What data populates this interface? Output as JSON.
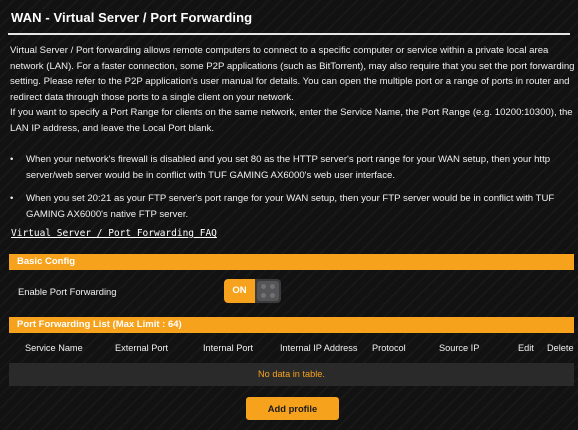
{
  "page": {
    "title": "WAN - Virtual Server / Port Forwarding",
    "description": [
      "Virtual Server / Port forwarding allows remote computers to connect to a specific computer or service within a private local area network (LAN). For a faster connection, some P2P applications (such as BitTorrent), may also require that you set the port forwarding setting. Please refer to the P2P application's user manual for details. You can open the multiple port or a range of ports in router and redirect data through those ports to a single client on your network.",
      "If you want to specify a Port Range for clients on the same network, enter the Service Name, the Port Range (e.g. 10200:10300), the LAN IP address, and leave the Local Port blank."
    ],
    "bullets": [
      "When your network's firewall is disabled and you set 80 as the HTTP server's port range for your WAN setup, then your http server/web server would be in conflict with TUF GAMING AX6000's web user interface.",
      "When you set 20:21 as your FTP server's port range for your WAN setup, then your FTP server would be in conflict with TUF GAMING AX6000's native FTP server."
    ],
    "bullet_glyph": "•",
    "faq_link": "Virtual Server / Port Forwarding FAQ"
  },
  "basic_config": {
    "header": "Basic Config",
    "enable_label": "Enable Port Forwarding",
    "toggle_state": "ON"
  },
  "forwarding_list": {
    "header": "Port Forwarding List (Max Limit : 64)",
    "columns": [
      "Service Name",
      "External Port",
      "Internal Port",
      "Internal IP Address",
      "Protocol",
      "Source IP",
      "Edit",
      "Delete"
    ],
    "empty_message": "No data in table.",
    "add_button": "Add profile"
  },
  "colors": {
    "accent": "#f6a21d",
    "background": "#121213",
    "empty_row": "#2a2a2b"
  }
}
